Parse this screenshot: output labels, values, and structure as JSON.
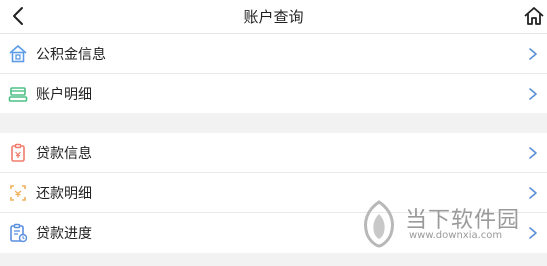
{
  "header": {
    "title": "账户查询",
    "back_icon": "chevron-left-icon",
    "home_icon": "home-icon"
  },
  "groups": [
    {
      "items": [
        {
          "label": "公积金信息",
          "icon": "house-icon",
          "icon_color": "#5b9be8"
        },
        {
          "label": "账户明细",
          "icon": "card-icon",
          "icon_color": "#4fbf86"
        }
      ]
    },
    {
      "items": [
        {
          "label": "贷款信息",
          "icon": "loan-info-icon",
          "icon_color": "#f07b6a"
        },
        {
          "label": "还款明细",
          "icon": "repayment-icon",
          "icon_color": "#f0b05a"
        },
        {
          "label": "贷款进度",
          "icon": "clipboard-progress-icon",
          "icon_color": "#5b8fe0"
        }
      ]
    }
  ],
  "watermark": {
    "title": "当下软件园",
    "url": "www.downxia.com"
  },
  "colors": {
    "chevron": "#5b8fd8",
    "background": "#f2f2f2"
  }
}
